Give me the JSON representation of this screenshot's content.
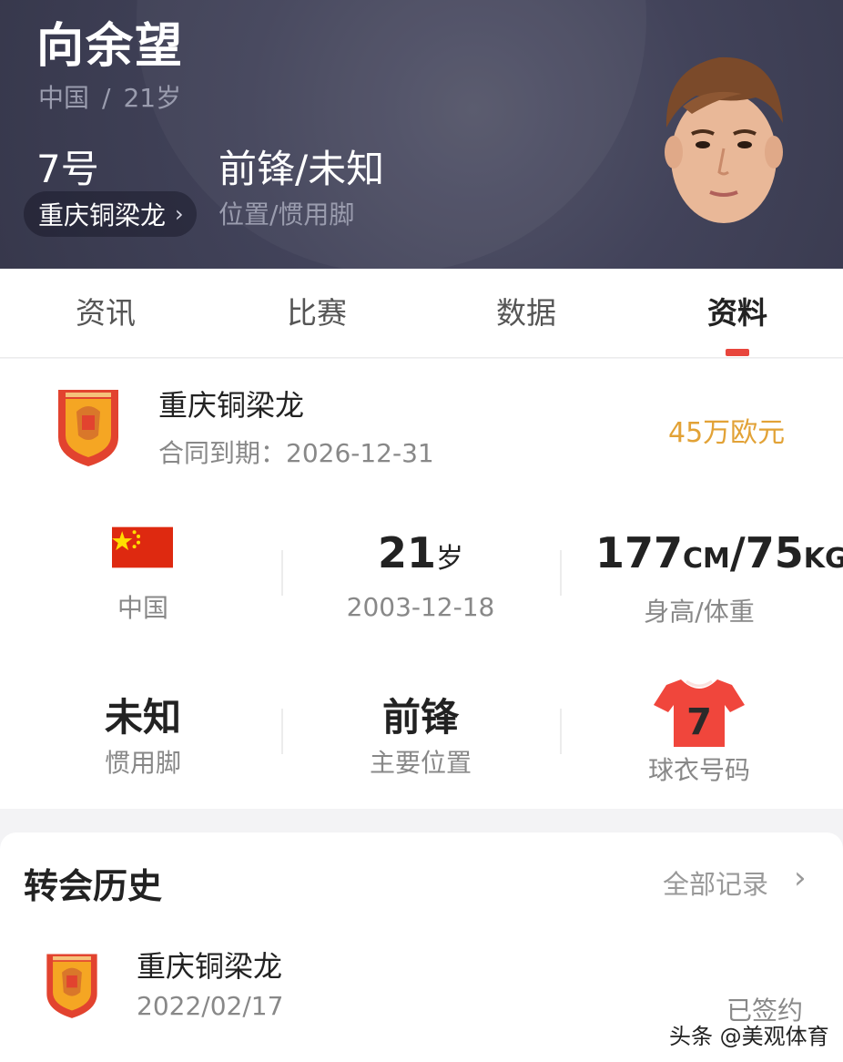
{
  "header": {
    "player_name": "向余望",
    "nationality": "中国",
    "separator": "/",
    "age": "21岁",
    "shirt_number": "7号",
    "position_foot": "前锋/未知",
    "club": "重庆铜梁龙",
    "position_foot_label": "位置/惯用脚"
  },
  "tabs": [
    {
      "label": "资讯"
    },
    {
      "label": "比赛"
    },
    {
      "label": "数据"
    },
    {
      "label": "资料"
    }
  ],
  "active_tab": "资料",
  "club_info": {
    "club_name": "重庆铜梁龙",
    "contract": "合同到期：2026-12-31",
    "market_value": "45万欧元"
  },
  "stats_row1": {
    "country_label": "中国",
    "age_value": "21",
    "age_unit": "岁",
    "birth_date": "2003-12-18",
    "height_value": "177",
    "height_unit": "CM",
    "hw_slash": "/",
    "weight_value": "75",
    "weight_unit": "KG",
    "hw_label": "身高/体重"
  },
  "stats_row2": {
    "foot_value": "未知",
    "foot_label": "惯用脚",
    "position_value": "前锋",
    "position_label": "主要位置",
    "jersey_number": "7",
    "jersey_label": "球衣号码"
  },
  "transfer": {
    "title": "转会历史",
    "all_records": "全部记录",
    "items": [
      {
        "club": "重庆铜梁龙",
        "date": "2022/02/17",
        "status": "已签约"
      }
    ]
  },
  "watermark": "头条 @美观体育",
  "colors": {
    "accent_red": "#e8453c",
    "value_gold": "#e2a236",
    "header_bg": "#3e3f55"
  }
}
